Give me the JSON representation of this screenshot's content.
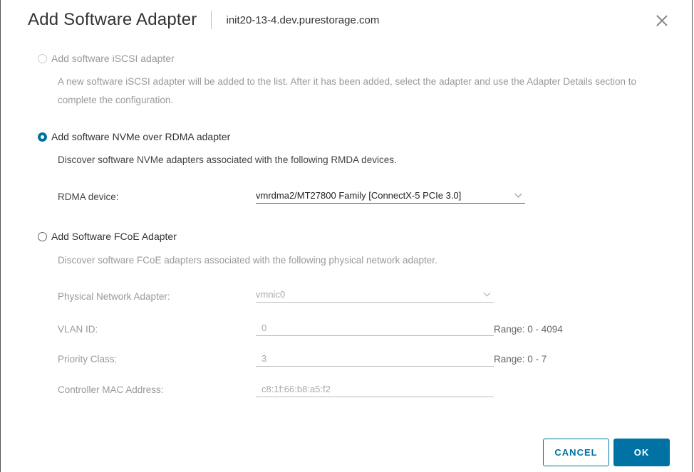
{
  "dialog": {
    "title": "Add Software Adapter",
    "host": "init20-13-4.dev.purestorage.com"
  },
  "options": {
    "iscsi": {
      "label": "Add software iSCSI adapter",
      "description": "A new software iSCSI adapter will be added to the list. After it has been added, select the adapter and use the Adapter Details section to complete the configuration.",
      "selected": false,
      "enabled": false
    },
    "nvme": {
      "label": "Add software NVMe over RDMA adapter",
      "description": "Discover software NVMe adapters associated with the following RMDA devices.",
      "selected": true,
      "rdma_label": "RDMA device:",
      "rdma_value": "vmrdma2/MT27800 Family [ConnectX-5 PCIe 3.0]"
    },
    "fcoe": {
      "label": "Add Software FCoE Adapter",
      "description": "Discover software FCoE adapters associated with the following physical network adapter.",
      "selected": false,
      "physical_label": "Physical Network Adapter:",
      "physical_value": "vmnic0",
      "vlan_label": "VLAN ID:",
      "vlan_value": "0",
      "vlan_range": "Range: 0 - 4094",
      "priority_label": "Priority Class:",
      "priority_value": "3",
      "priority_range": "Range: 0 - 7",
      "mac_label": "Controller MAC Address:",
      "mac_value": "c8:1f:66:b8:a5:f2"
    }
  },
  "buttons": {
    "cancel": "CANCEL",
    "ok": "OK"
  },
  "colors": {
    "accent": "#0072a3"
  }
}
